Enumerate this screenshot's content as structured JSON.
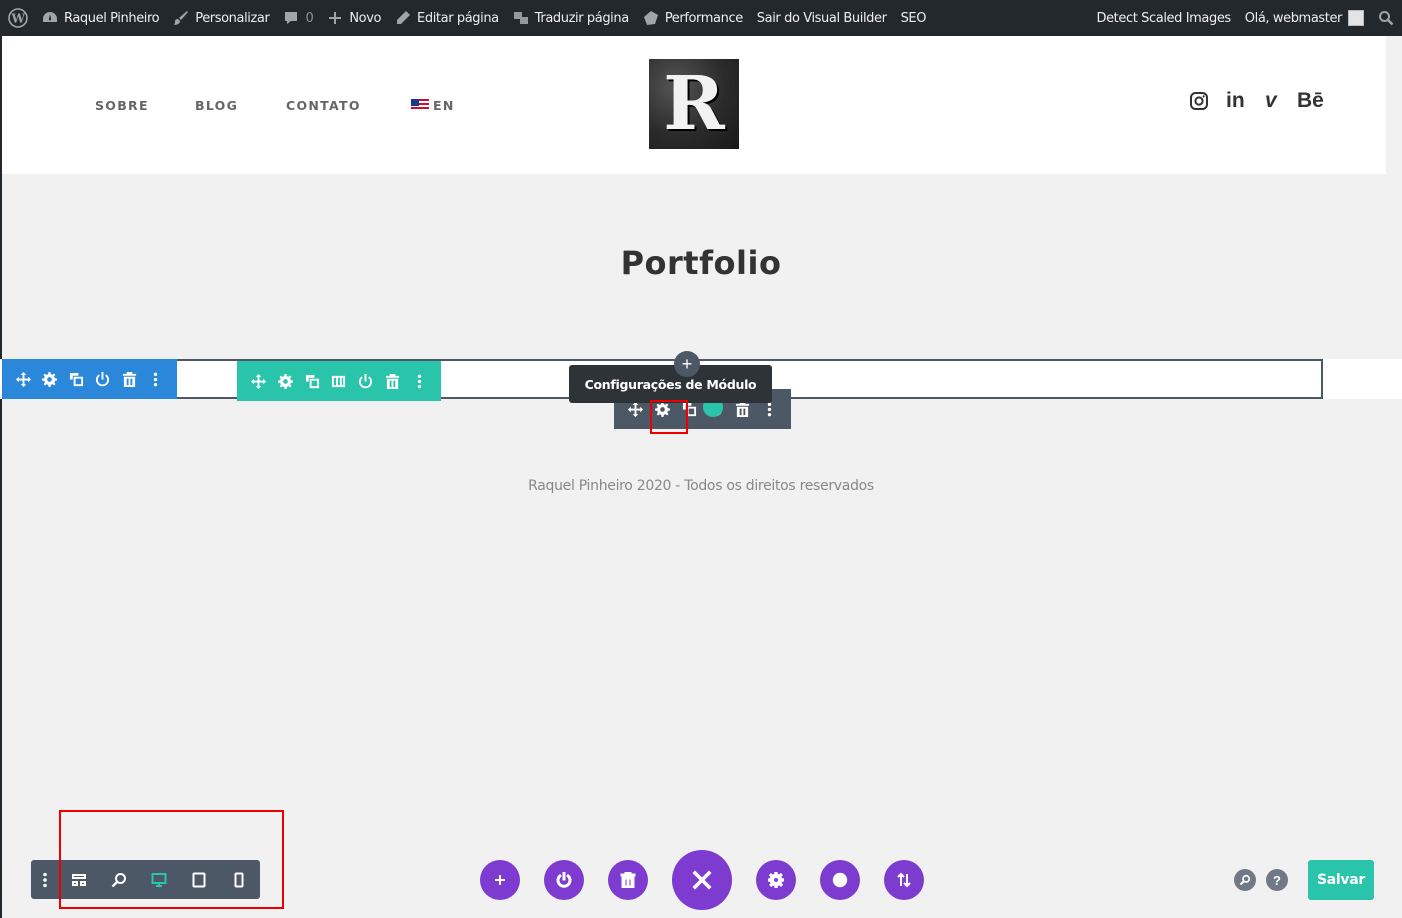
{
  "adminbar": {
    "site_name": "Raquel Pinheiro",
    "customize": "Personalizar",
    "comments_count": "0",
    "new": "Novo",
    "edit_page": "Editar página",
    "translate_page": "Traduzir página",
    "performance": "Performance",
    "exit_builder": "Sair do Visual Builder",
    "seo": "SEO",
    "detect_scaled": "Detect Scaled Images",
    "greeting": "Olá, webmaster"
  },
  "header": {
    "nav": [
      "SOBRE",
      "BLOG",
      "CONTATO"
    ],
    "language": "EN",
    "logo_letter": "R",
    "social": {
      "instagram": "instagram-icon",
      "linkedin": "in",
      "vimeo": "v",
      "behance": "Bē"
    }
  },
  "page": {
    "title": "Portfolio",
    "footer_text": "Raquel Pinheiro 2020 - Todos os direitos reservados"
  },
  "builder": {
    "tooltip": "Configurações de Módulo",
    "add_symbol": "+",
    "save_label": "Salvar",
    "help_label": "?",
    "colors": {
      "section": "#2b87da",
      "row": "#29c4a9",
      "module": "#4c5866",
      "page_actions": "#7e3bd0",
      "highlight": "#e00000"
    }
  }
}
